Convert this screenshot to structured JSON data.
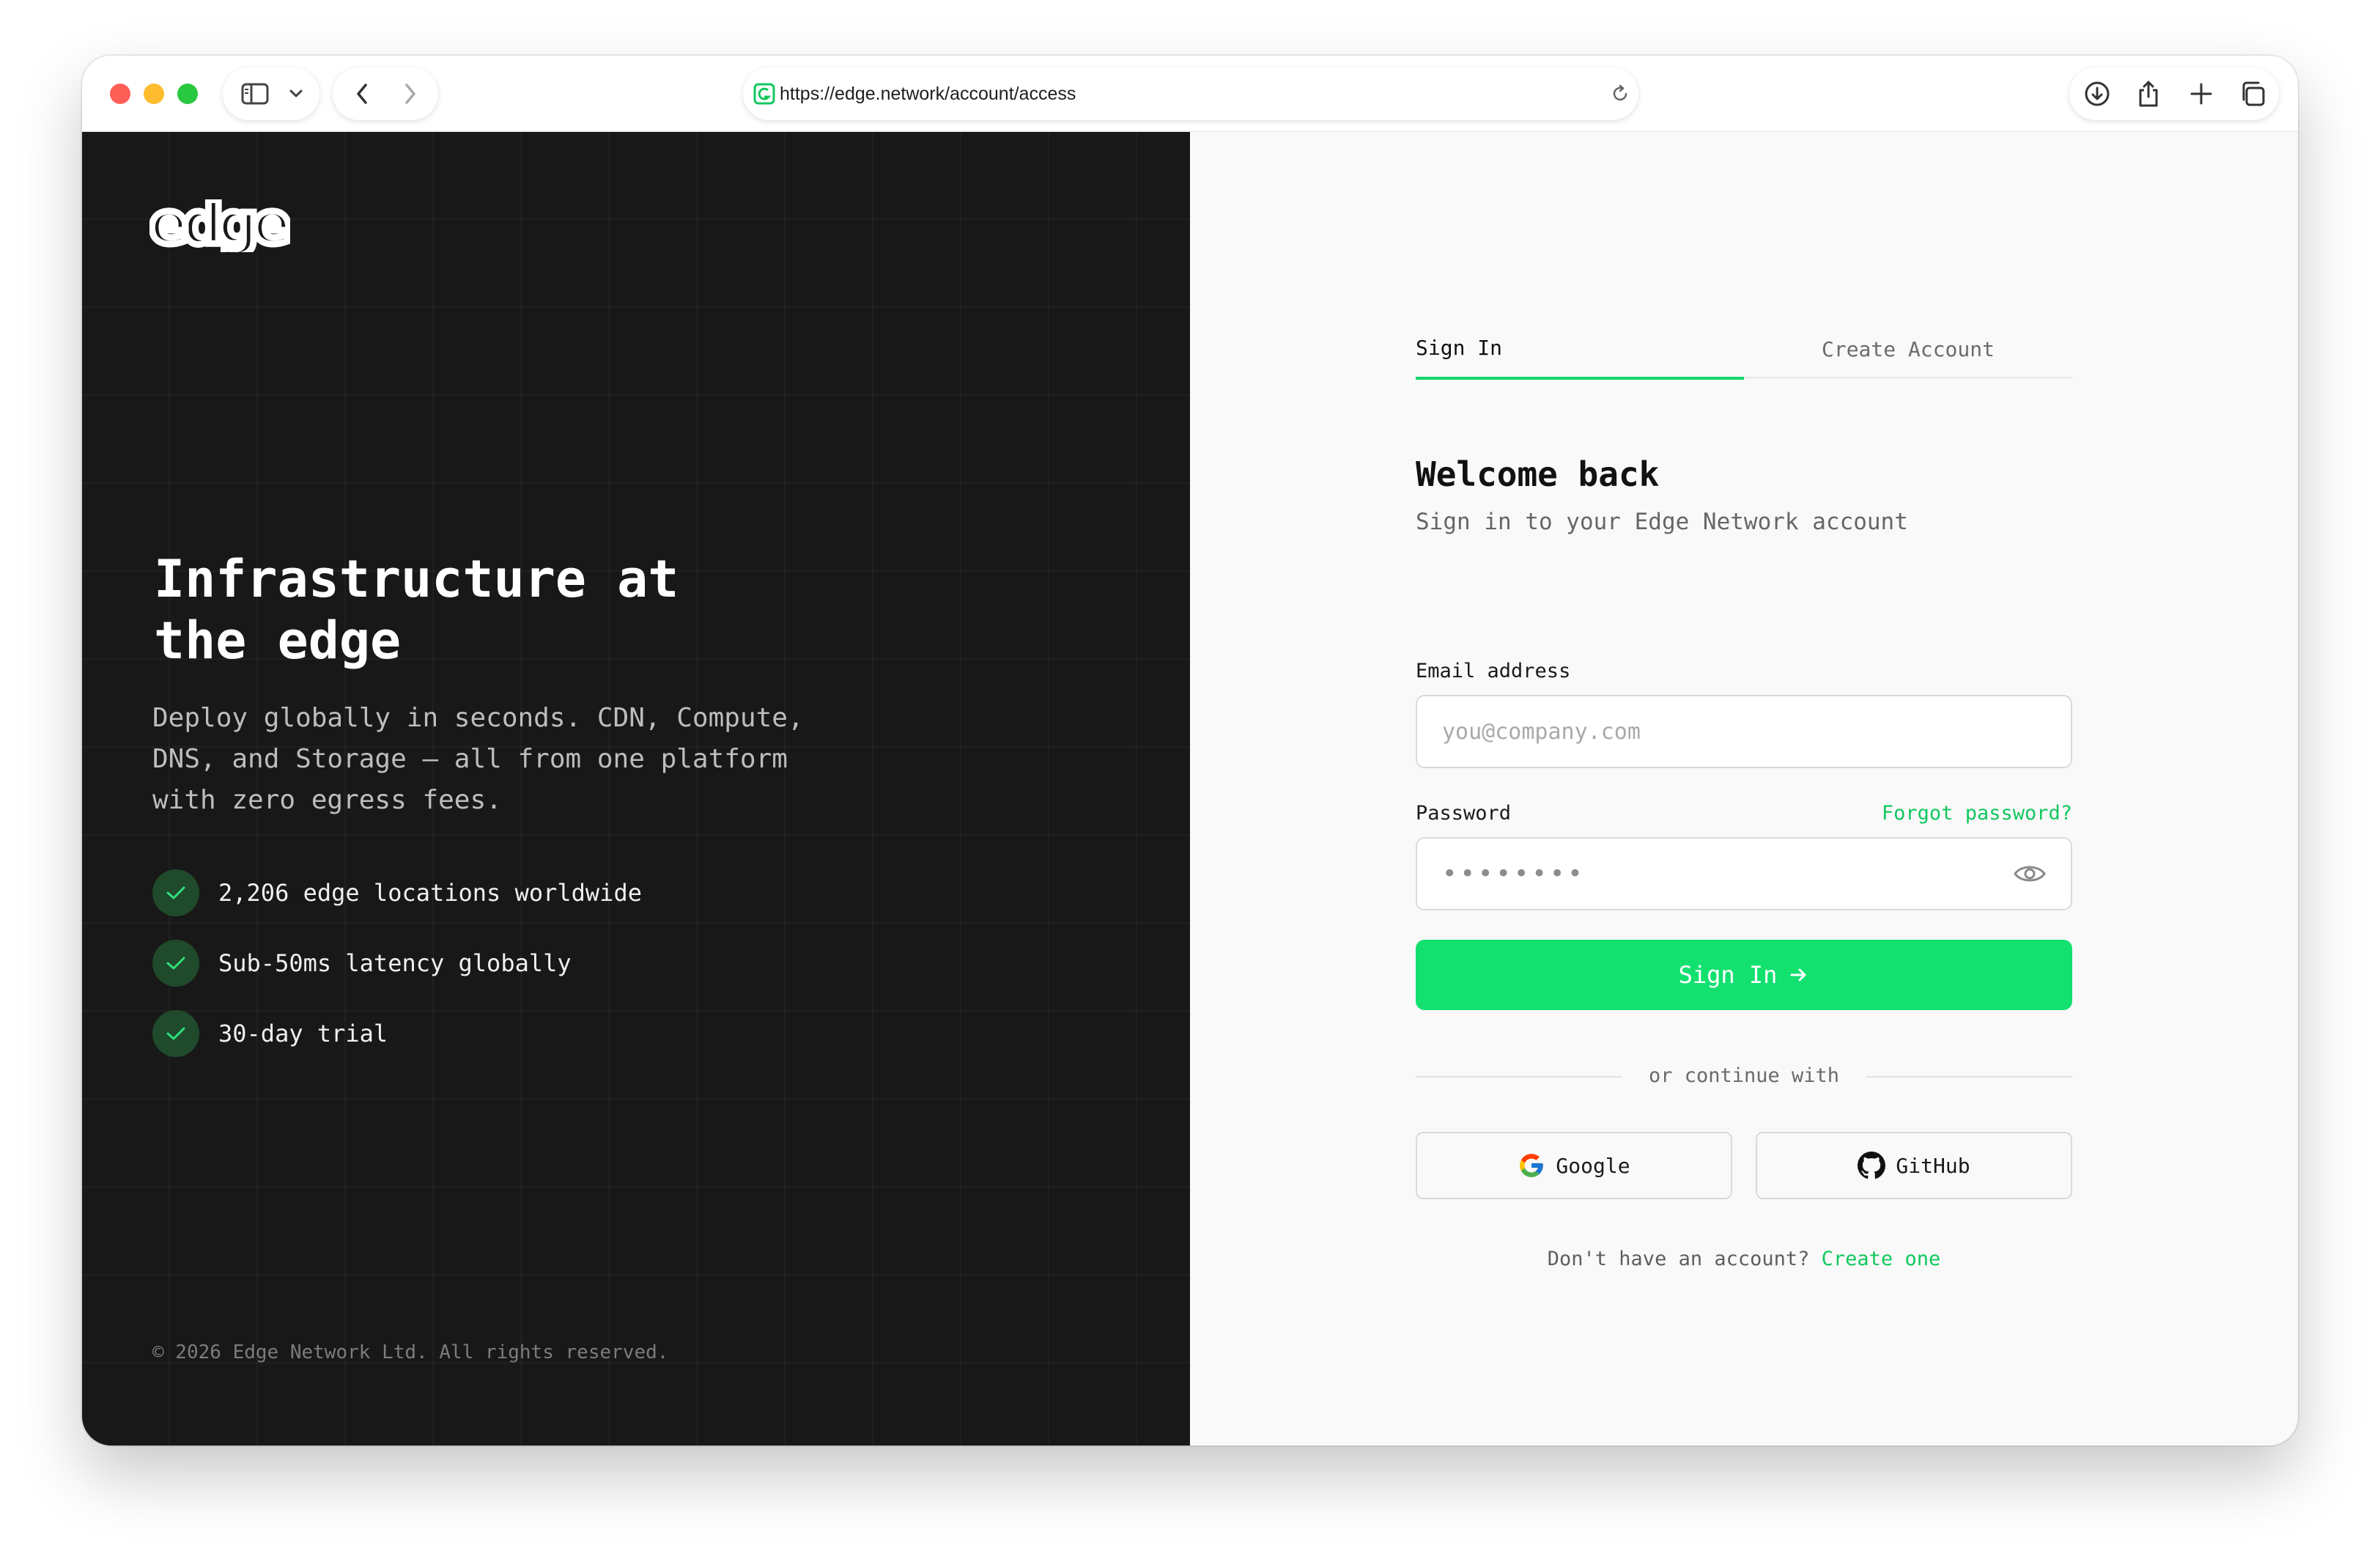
{
  "browser": {
    "url": "https://edge.network/account/access"
  },
  "brand": {
    "logo_text": "edge",
    "accent": "#12e06f",
    "dark_bg": "#181818"
  },
  "hero": {
    "title_line1": "Infrastructure at",
    "title_line2": "the edge",
    "desc_line1": "Deploy globally in seconds. CDN, Compute,",
    "desc_line2": "DNS, and Storage — all from one platform",
    "desc_line3": "with zero egress fees.",
    "features": [
      "2,206 edge locations worldwide",
      "Sub-50ms latency globally",
      "30-day trial"
    ],
    "copyright": "© 2026 Edge Network Ltd. All rights reserved."
  },
  "auth": {
    "tabs": [
      "Sign In",
      "Create Account"
    ],
    "active_tab": "Sign In",
    "title": "Welcome back",
    "subtitle": "Sign in to your Edge Network account",
    "email_label": "Email address",
    "email_placeholder": "you@company.com",
    "email_value": "",
    "password_label": "Password",
    "forgot_label": "Forgot password?",
    "password_mask": "••••••••",
    "submit_label": "Sign In",
    "divider_text": "or continue with",
    "google_label": "Google",
    "github_label": "GitHub",
    "signup_prompt": "Don't have an account?",
    "signup_link": "Create one"
  }
}
